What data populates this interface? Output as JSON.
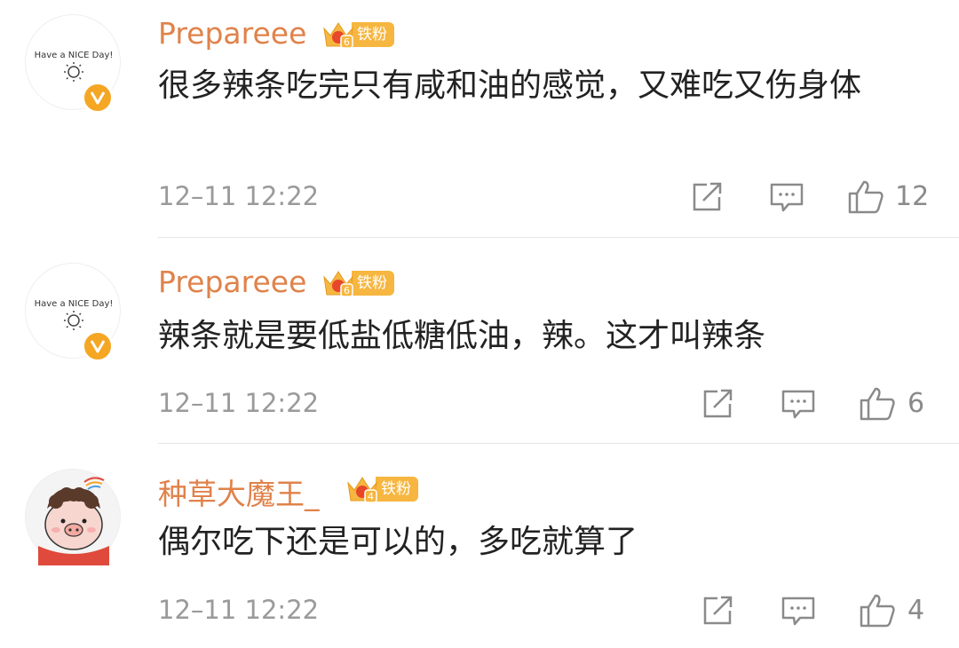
{
  "comments": [
    {
      "username": "Prepareee",
      "fan_level": "6",
      "fan_badge": "铁粉",
      "verified_icon": "v-verified-badge",
      "avatar_text": "Have a NICE Day!",
      "text": "很多辣条吃完只有咸和油的感觉，又难吃又伤身体",
      "time": "12–11 12:22",
      "likes": "12"
    },
    {
      "username": "Prepareee",
      "fan_level": "6",
      "fan_badge": "铁粉",
      "verified_icon": "v-verified-badge",
      "avatar_text": "Have a NICE Day!",
      "text": "辣条就是要低盐低糖低油，辣。这才叫辣条",
      "time": "12–11 12:22",
      "likes": "6"
    },
    {
      "username": "种草大魔王_",
      "fan_level": "4",
      "fan_badge": "铁粉",
      "avatar_icon": "pig-cartoon-avatar",
      "text": "偶尔吃下还是可以的，多吃就算了",
      "time": "12–11 12:22",
      "likes": "4"
    }
  ],
  "colors": {
    "username": "#e0824a",
    "badge": "#f6b640",
    "verified": "#f5a623",
    "meta": "#9a9a9a"
  },
  "icons": [
    "share-icon",
    "comment-icon",
    "thumbs-up-icon"
  ]
}
